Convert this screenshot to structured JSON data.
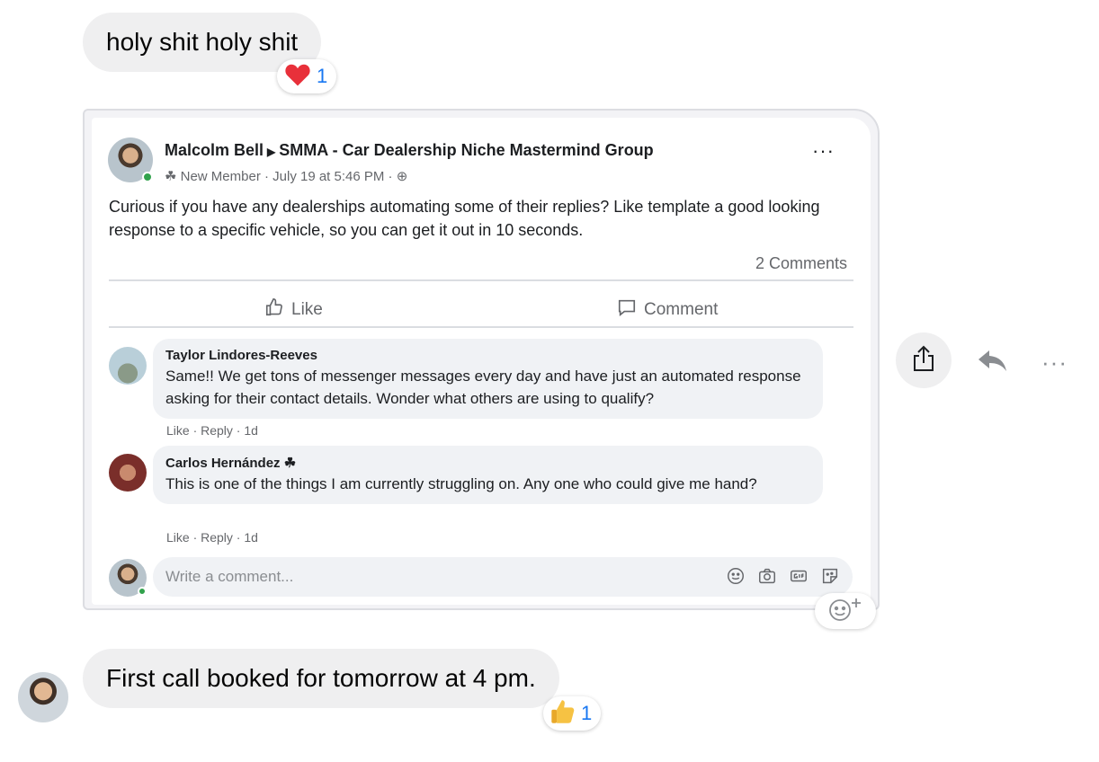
{
  "messages": [
    {
      "text": "holy shit holy shit",
      "reaction": {
        "emoji": "heart",
        "count": "1"
      }
    },
    {
      "text": "First call booked for tomorrow at 4 pm.",
      "reaction": {
        "emoji": "thumbs-up",
        "count": "1"
      }
    }
  ],
  "post": {
    "author": "Malcolm Bell",
    "group": "SMMA - Car Dealership Niche Mastermind Group",
    "meta": "New Member · July 19 at 5:46 PM ·",
    "more": "···",
    "text": "Curious if you have any dealerships automating some of their replies? Like template a good looking response to a specific vehicle, so you can get it out in 10 seconds.",
    "comments_count": "2 Comments",
    "like_label": "Like",
    "comment_label": "Comment",
    "comments": [
      {
        "name": "Taylor Lindores-Reeves",
        "text": "Same!! We get tons of messenger messages every day and have just an automated response asking for their contact details. Wonder what others are using to qualify?",
        "actions": "Like · Reply · 1d"
      },
      {
        "name": "Carlos Hernández",
        "text": "This is one of the things I am currently struggling on. Any one who could give me hand?",
        "actions": "Like · Reply · 1d"
      }
    ],
    "write_placeholder": "Write a comment..."
  },
  "actions": {
    "more": "···"
  },
  "colors": {
    "accent": "#1877f2",
    "bubble": "#efeff0",
    "online": "#31a24c"
  }
}
